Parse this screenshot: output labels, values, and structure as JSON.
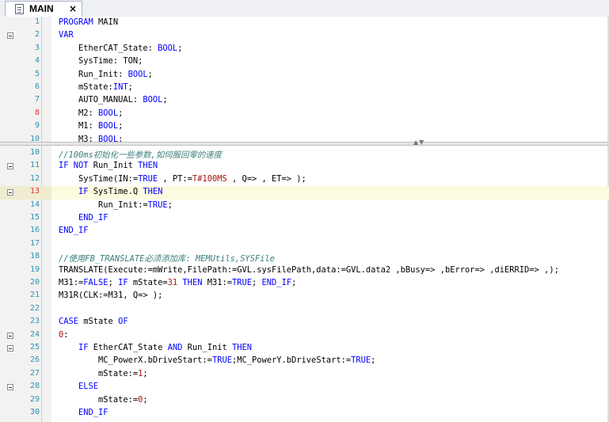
{
  "tab": {
    "label": "MAIN",
    "close": "×"
  },
  "splitter": {
    "arrows": "▲▼"
  },
  "declaration": [
    {
      "n": "1",
      "fold": false,
      "red": false,
      "tokens": [
        [
          "kw",
          "PROGRAM "
        ],
        [
          "vr",
          "MAIN"
        ]
      ]
    },
    {
      "n": "2",
      "fold": true,
      "red": false,
      "tokens": [
        [
          "kw",
          "VAR"
        ]
      ]
    },
    {
      "n": "3",
      "fold": false,
      "red": false,
      "tokens": [
        [
          "vr",
          "    EtherCAT_State: "
        ],
        [
          "kw",
          "BOOL"
        ],
        [
          "op",
          ";"
        ]
      ]
    },
    {
      "n": "4",
      "fold": false,
      "red": false,
      "tokens": [
        [
          "vr",
          "    SysTime: TON;"
        ]
      ]
    },
    {
      "n": "5",
      "fold": false,
      "red": false,
      "tokens": [
        [
          "vr",
          "    Run_Init: "
        ],
        [
          "kw",
          "BOOL"
        ],
        [
          "op",
          ";"
        ]
      ]
    },
    {
      "n": "6",
      "fold": false,
      "red": false,
      "tokens": [
        [
          "vr",
          "    mState:"
        ],
        [
          "kw",
          "INT"
        ],
        [
          "op",
          ";"
        ]
      ]
    },
    {
      "n": "7",
      "fold": false,
      "red": false,
      "tokens": [
        [
          "vr",
          "    AUTO_MANUAL: "
        ],
        [
          "kw",
          "BOOL"
        ],
        [
          "op",
          ";"
        ]
      ]
    },
    {
      "n": "8",
      "fold": false,
      "red": true,
      "tokens": [
        [
          "vr",
          "    M2: "
        ],
        [
          "kw",
          "BOOL"
        ],
        [
          "op",
          ";"
        ]
      ]
    },
    {
      "n": "9",
      "fold": false,
      "red": false,
      "tokens": [
        [
          "vr",
          "    M1: "
        ],
        [
          "kw",
          "BOOL"
        ],
        [
          "op",
          ";"
        ]
      ]
    },
    {
      "n": "10",
      "fold": false,
      "red": false,
      "tokens": [
        [
          "vr",
          "    M3: "
        ],
        [
          "kw",
          "BOOL"
        ],
        [
          "op",
          ";"
        ]
      ]
    }
  ],
  "implementation": [
    {
      "n": "10",
      "fold": false,
      "red": false,
      "tokens": [
        [
          "cm",
          "//100ms初始化一些参数,如伺服回零的速度"
        ]
      ]
    },
    {
      "n": "11",
      "fold": true,
      "red": false,
      "tokens": [
        [
          "kw",
          "IF NOT "
        ],
        [
          "vr",
          "Run_Init "
        ],
        [
          "kw",
          "THEN"
        ]
      ]
    },
    {
      "n": "12",
      "fold": false,
      "red": false,
      "tokens": [
        [
          "vr",
          "    SysTime(IN:="
        ],
        [
          "kw",
          "TRUE"
        ],
        [
          "vr",
          " , PT:="
        ],
        [
          "lit",
          "T#100MS"
        ],
        [
          "vr",
          " , Q=> , ET=> );"
        ]
      ]
    },
    {
      "n": "13",
      "fold": true,
      "red": true,
      "highlight": true,
      "tokens": [
        [
          "kw",
          "    IF "
        ],
        [
          "vr",
          "SysTime.Q "
        ],
        [
          "kw",
          "THEN"
        ]
      ]
    },
    {
      "n": "14",
      "fold": false,
      "red": false,
      "tokens": [
        [
          "vr",
          "        Run_Init:="
        ],
        [
          "kw",
          "TRUE"
        ],
        [
          "op",
          ";"
        ]
      ]
    },
    {
      "n": "15",
      "fold": false,
      "red": false,
      "tokens": [
        [
          "kw",
          "    END_IF"
        ]
      ]
    },
    {
      "n": "16",
      "fold": false,
      "red": false,
      "tokens": [
        [
          "kw",
          "END_IF"
        ]
      ]
    },
    {
      "n": "17",
      "fold": false,
      "red": false,
      "tokens": [
        [
          "vr",
          ""
        ]
      ]
    },
    {
      "n": "18",
      "fold": false,
      "red": false,
      "tokens": [
        [
          "cm",
          "//使用FB_TRANSLATE必须添加库: MEMUtils,SYSFile"
        ]
      ]
    },
    {
      "n": "19",
      "fold": false,
      "red": false,
      "tokens": [
        [
          "vr",
          "TRANSLATE(Execute:=mWrite,FilePath:=GVL.sysFilePath,data:=GVL.data2 ,bBusy=> ,bError=> ,diERRID=> ,);"
        ]
      ]
    },
    {
      "n": "20",
      "fold": false,
      "red": false,
      "tokens": [
        [
          "vr",
          "M31:="
        ],
        [
          "kw",
          "FALSE"
        ],
        [
          "vr",
          "; "
        ],
        [
          "kw",
          "IF "
        ],
        [
          "vr",
          "mState="
        ],
        [
          "lit",
          "31"
        ],
        [
          "kw",
          " THEN "
        ],
        [
          "vr",
          "M31:="
        ],
        [
          "kw",
          "TRUE"
        ],
        [
          "vr",
          "; "
        ],
        [
          "kw",
          "END_IF"
        ],
        [
          "op",
          ";"
        ]
      ]
    },
    {
      "n": "21",
      "fold": false,
      "red": false,
      "tokens": [
        [
          "vr",
          "M31R(CLK:=M31, Q=> );"
        ]
      ]
    },
    {
      "n": "22",
      "fold": false,
      "red": false,
      "tokens": [
        [
          "vr",
          ""
        ]
      ]
    },
    {
      "n": "23",
      "fold": false,
      "red": false,
      "tokens": [
        [
          "kw",
          "CASE "
        ],
        [
          "vr",
          "mState "
        ],
        [
          "kw",
          "OF"
        ]
      ]
    },
    {
      "n": "24",
      "fold": true,
      "red": false,
      "tokens": [
        [
          "lit",
          "0"
        ],
        [
          "op",
          ":"
        ]
      ]
    },
    {
      "n": "25",
      "fold": true,
      "red": false,
      "tokens": [
        [
          "kw",
          "    IF "
        ],
        [
          "vr",
          "EtherCAT_State "
        ],
        [
          "kw",
          "AND "
        ],
        [
          "vr",
          "Run_Init "
        ],
        [
          "kw",
          "THEN"
        ]
      ]
    },
    {
      "n": "26",
      "fold": false,
      "red": false,
      "tokens": [
        [
          "vr",
          "        MC_PowerX.bDriveStart:="
        ],
        [
          "kw",
          "TRUE"
        ],
        [
          "vr",
          ";MC_PowerY.bDriveStart:="
        ],
        [
          "kw",
          "TRUE"
        ],
        [
          "op",
          ";"
        ]
      ]
    },
    {
      "n": "27",
      "fold": false,
      "red": false,
      "tokens": [
        [
          "vr",
          "        mState:="
        ],
        [
          "lit",
          "1"
        ],
        [
          "op",
          ";"
        ]
      ]
    },
    {
      "n": "28",
      "fold": true,
      "red": false,
      "tokens": [
        [
          "kw",
          "    ELSE"
        ]
      ]
    },
    {
      "n": "29",
      "fold": false,
      "red": false,
      "tokens": [
        [
          "vr",
          "        mState:="
        ],
        [
          "lit",
          "0"
        ],
        [
          "op",
          ";"
        ]
      ]
    },
    {
      "n": "30",
      "fold": false,
      "red": false,
      "tokens": [
        [
          "kw",
          "    END_IF"
        ]
      ]
    }
  ]
}
